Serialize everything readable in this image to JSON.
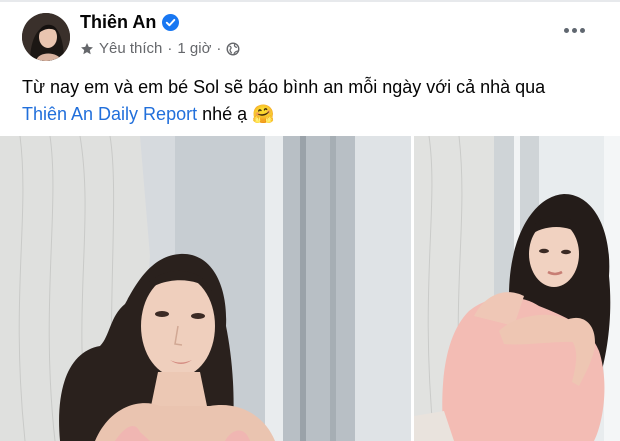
{
  "post": {
    "author": "Thiên An",
    "audience": "Yêu thích",
    "separator": "·",
    "time": "1 giờ",
    "text_line1": "Từ nay em và em bé Sol sẽ báo bình an mỗi ngày với cả nhà qua",
    "tag": "Thiên An Daily Report",
    "text_line2": " nhé ạ ",
    "emoji": "🤗"
  },
  "icons": {
    "verified": "verified-badge-icon",
    "favorite": "star-icon",
    "privacy": "globe-icon",
    "more": "more-options-icon"
  },
  "colors": {
    "verified_blue": "#1877f2",
    "link_blue": "#216fdb",
    "meta_gray": "#65676b",
    "text": "#050505"
  }
}
